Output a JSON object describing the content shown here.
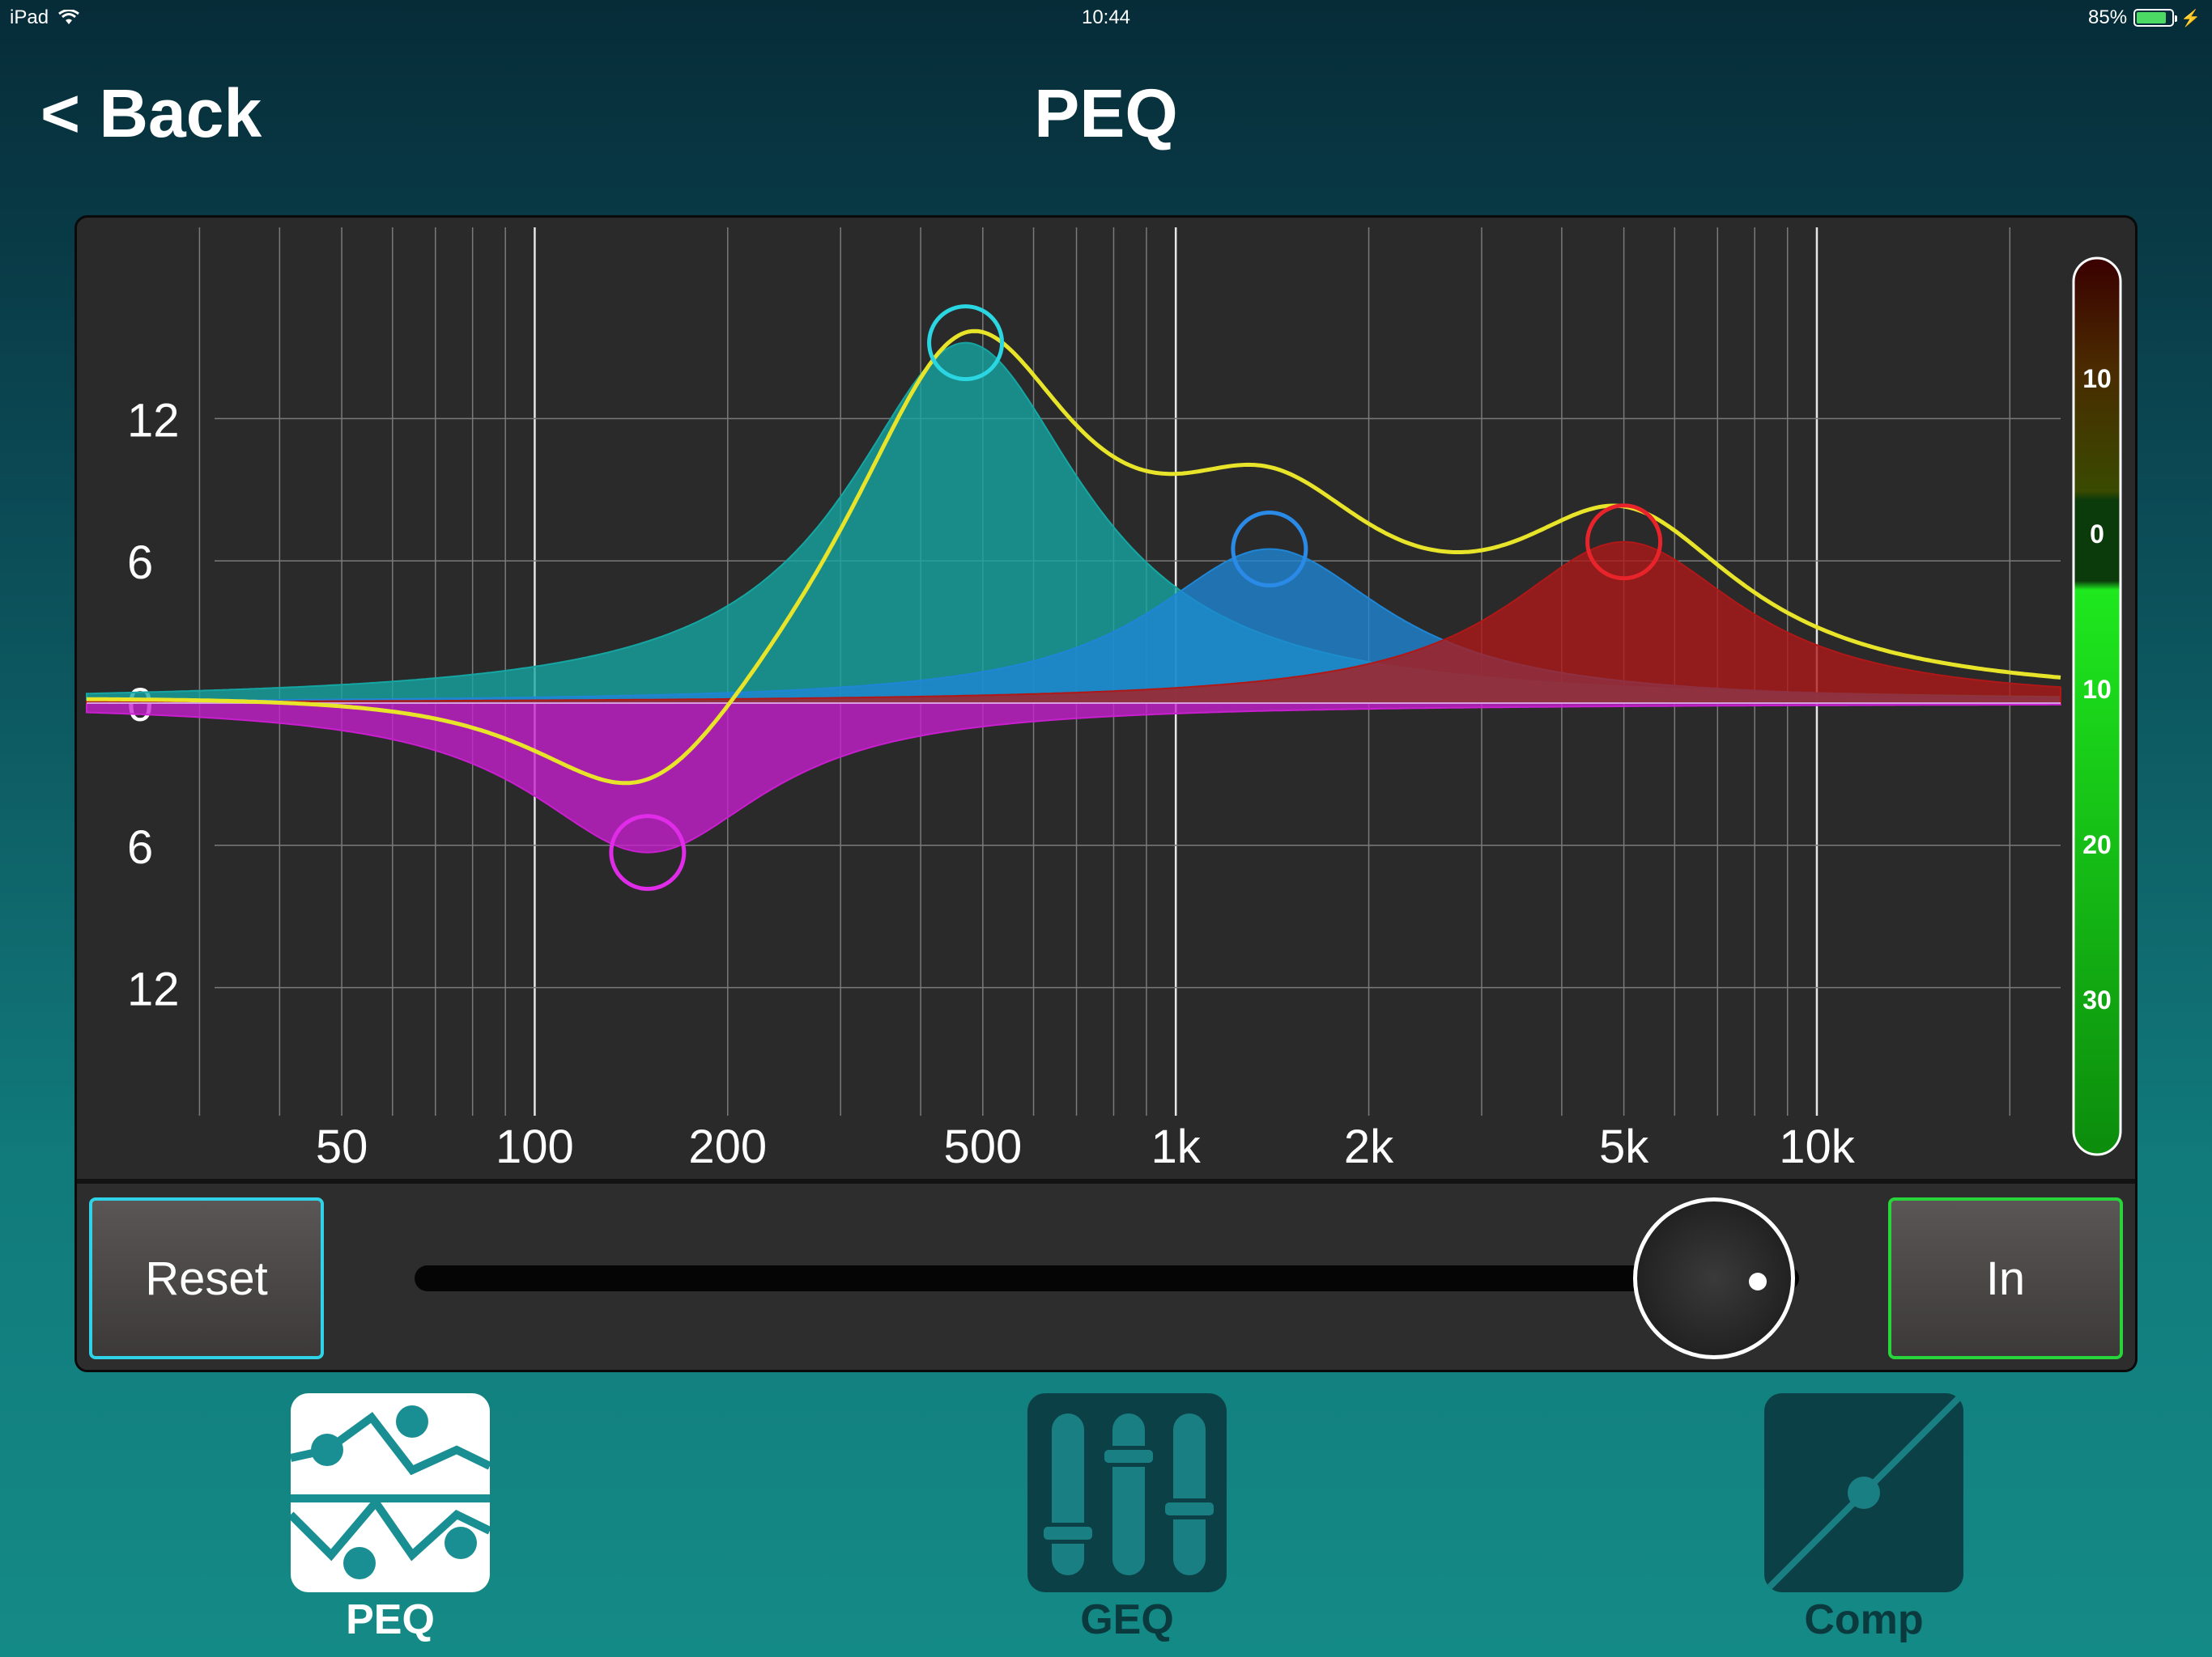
{
  "status_bar": {
    "device": "iPad",
    "time": "10:44",
    "battery": "85%",
    "battery_level": 0.85
  },
  "header": {
    "back_label": "< Back",
    "title": "PEQ"
  },
  "eq": {
    "gain_labels": [
      "12",
      "6",
      "0",
      "6",
      "12"
    ],
    "freq_labels": [
      "50",
      "100",
      "200",
      "500",
      "1k",
      "2k",
      "5k",
      "10k"
    ],
    "meter_labels": [
      "10",
      "0",
      "10",
      "20",
      "30"
    ],
    "bands": [
      {
        "name": "band-1",
        "freq_hz": 150,
        "gain_db": -6.3,
        "color": "#c81fcf",
        "handle_color": "#e02ce8"
      },
      {
        "name": "band-2",
        "freq_hz": 470,
        "gain_db": 15.2,
        "color": "#15a6a3",
        "handle_color": "#2ad6e2"
      },
      {
        "name": "band-3",
        "freq_hz": 1400,
        "gain_db": 6.5,
        "color": "#1f86d6",
        "handle_color": "#2a8ae8"
      },
      {
        "name": "band-4",
        "freq_hz": 5000,
        "gain_db": 6.8,
        "color": "#b01818",
        "handle_color": "#e8242a"
      }
    ],
    "curve_color": "#e8e42a"
  },
  "controls": {
    "reset_label": "Reset",
    "in_label": "In",
    "slider_value": 0.95
  },
  "tabs": [
    {
      "label": "PEQ",
      "icon": "peq-icon",
      "active": true
    },
    {
      "label": "GEQ",
      "icon": "geq-icon",
      "active": false
    },
    {
      "label": "Comp",
      "icon": "comp-icon",
      "active": false
    }
  ]
}
